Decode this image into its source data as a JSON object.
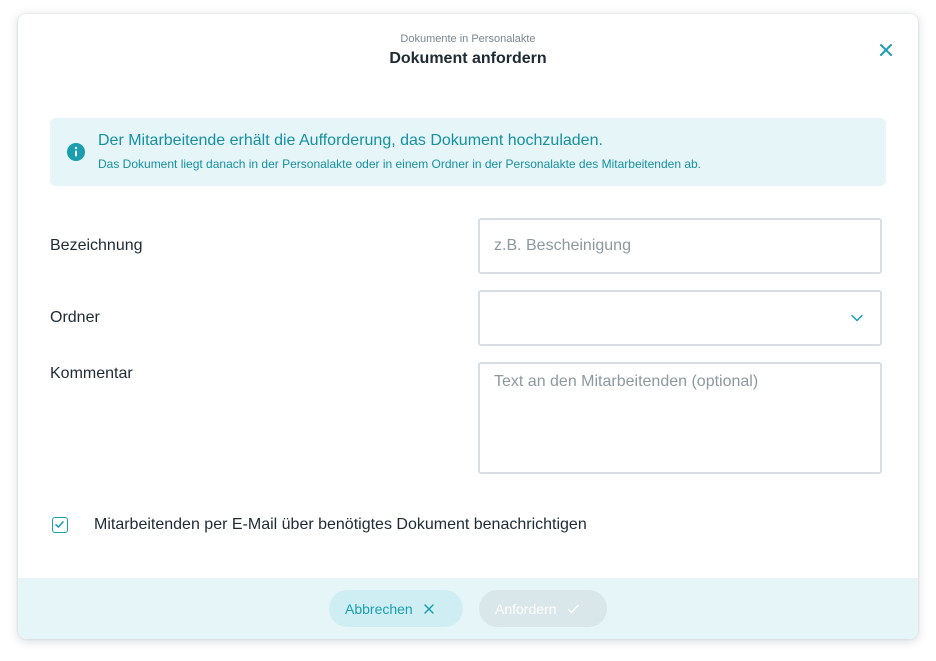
{
  "header": {
    "subtitle": "Dokumente in Personalakte",
    "title": "Dokument anfordern",
    "close_icon": "close-icon"
  },
  "info": {
    "icon": "info-icon",
    "main_text": "Der Mitarbeitende erhält die Aufforderung, das Dokument hochzuladen.",
    "sub_text": "Das Dokument liegt danach in der Personalakte oder in einem Ordner in der Personalakte des Mitarbeitenden ab."
  },
  "form": {
    "bezeichnung": {
      "label": "Bezeichnung",
      "value": "",
      "placeholder": "z.B. Bescheinigung"
    },
    "ordner": {
      "label": "Ordner",
      "value": ""
    },
    "kommentar": {
      "label": "Kommentar",
      "value": "",
      "placeholder": "Text an den Mitarbeitenden (optional)"
    }
  },
  "notify": {
    "label": "Mitarbeitenden per E-Mail über benötigtes Dokument benachrichtigen",
    "checked": true
  },
  "footer": {
    "cancel_label": "Abbrechen",
    "submit_label": "Anfordern",
    "submit_disabled": true
  },
  "colors": {
    "accent": "#1a9eb0",
    "info_background": "#e6f5f7",
    "text": "#1f2a33"
  }
}
